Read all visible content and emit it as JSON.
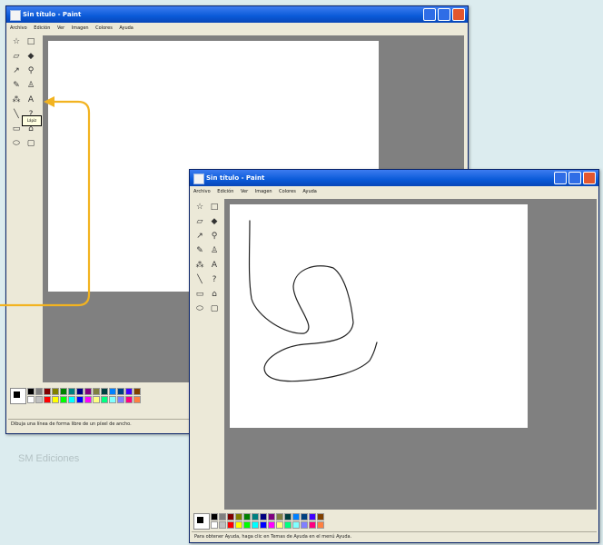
{
  "window1": {
    "title": "Sin título - Paint",
    "menu": [
      "Archivo",
      "Edición",
      "Ver",
      "Imagen",
      "Colores",
      "Ayuda"
    ],
    "tooltip": "Lápiz",
    "status": "Dibuja una línea de forma libre de un píxel de ancho."
  },
  "window2": {
    "title": "Sin título - Paint",
    "menu": [
      "Archivo",
      "Edición",
      "Ver",
      "Imagen",
      "Colores",
      "Ayuda"
    ],
    "status": "Para obtener Ayuda, haga clic en Temas de Ayuda en el menú Ayuda."
  },
  "tool_icons": [
    "free-select-icon",
    "rect-select-icon",
    "eraser-icon",
    "fill-icon",
    "color-picker-icon",
    "magnifier-icon",
    "pencil-icon",
    "brush-icon",
    "airbrush-icon",
    "text-icon",
    "line-icon",
    "curve-icon",
    "rectangle-icon",
    "polygon-icon",
    "ellipse-icon",
    "rounded-rect-icon"
  ],
  "palette_colors": [
    "#000000",
    "#808080",
    "#800000",
    "#808000",
    "#008000",
    "#008080",
    "#000080",
    "#800080",
    "#808040",
    "#004040",
    "#0080ff",
    "#004080",
    "#4000ff",
    "#804000",
    "#ffffff",
    "#c0c0c0",
    "#ff0000",
    "#ffff00",
    "#00ff00",
    "#00ffff",
    "#0000ff",
    "#ff00ff",
    "#ffff80",
    "#00ff80",
    "#80ffff",
    "#8080ff",
    "#ff0080",
    "#ff8040"
  ],
  "accent_arrow_color": "#f2b320",
  "credit": "SM Ediciones"
}
